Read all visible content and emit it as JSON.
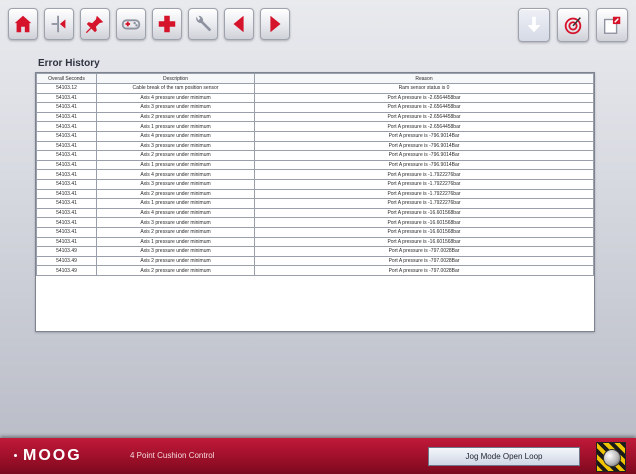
{
  "toolbar": {
    "left_icons": [
      "home-icon",
      "jog-icon",
      "pin-icon",
      "gamepad-icon",
      "add-icon",
      "wrench-icon",
      "arrow-left-icon",
      "arrow-right-icon"
    ],
    "right_icons": [
      "download-icon",
      "target-icon",
      "exit-icon"
    ],
    "colors": {
      "red": "#d5142b",
      "gray": "#8f93a0"
    }
  },
  "page": {
    "title": "Error History"
  },
  "table": {
    "headers": [
      "Overall Seconds",
      "Description",
      "Reason"
    ],
    "rows": [
      [
        "54103.12",
        "Cable break of the ram position sensor",
        "Ram sensor status is 0"
      ],
      [
        "54103.41",
        "Axis 4 pressure under minimum",
        "Port A pressure is -2.6564458bar"
      ],
      [
        "54103.41",
        "Axis 3 pressure under minimum",
        "Port A pressure is -2.6564458bar"
      ],
      [
        "54103.41",
        "Axis 2 pressure under minimum",
        "Port A pressure is -2.6564458bar"
      ],
      [
        "54103.41",
        "Axis 1 pressure under minimum",
        "Port A pressure is -2.6564458bar"
      ],
      [
        "54103.41",
        "Axis 4 pressure under minimum",
        "Port A pressure is -796.9014Bar"
      ],
      [
        "54103.41",
        "Axis 3 pressure under minimum",
        "Port A pressure is -796.9014Bar"
      ],
      [
        "54103.41",
        "Axis 2 pressure under minimum",
        "Port A pressure is -796.9014Bar"
      ],
      [
        "54103.41",
        "Axis 1 pressure under minimum",
        "Port A pressure is -796.9014Bar"
      ],
      [
        "54103.41",
        "Axis 4 pressure under minimum",
        "Port A pressure is -1.7922276bar"
      ],
      [
        "54103.41",
        "Axis 3 pressure under minimum",
        "Port A pressure is -1.7922276bar"
      ],
      [
        "54103.41",
        "Axis 2 pressure under minimum",
        "Port A pressure is -1.7922276bar"
      ],
      [
        "54103.41",
        "Axis 1 pressure under minimum",
        "Port A pressure is -1.7922276bar"
      ],
      [
        "54103.41",
        "Axis 4 pressure under minimum",
        "Port A pressure is -16.601568bar"
      ],
      [
        "54103.41",
        "Axis 3 pressure under minimum",
        "Port A pressure is -16.601568bar"
      ],
      [
        "54103.41",
        "Axis 2 pressure under minimum",
        "Port A pressure is -16.601568bar"
      ],
      [
        "54103.41",
        "Axis 1 pressure under minimum",
        "Port A pressure is -16.601568bar"
      ],
      [
        "54103.49",
        "Axis 3 pressure under minimum",
        "Port A pressure is -797.0028Bar"
      ],
      [
        "54103.49",
        "Axis 2 pressure under minimum",
        "Port A pressure is -797.0028Bar"
      ],
      [
        "54103.49",
        "Axis 2 pressure under minimum",
        "Port A pressure is -797.0028Bar"
      ]
    ]
  },
  "footer": {
    "logo": "MOOG",
    "app_name": "4 Point Cushion Control",
    "mode": "Jog Mode Open Loop",
    "estop_icon": "emergency-stop-icon"
  }
}
